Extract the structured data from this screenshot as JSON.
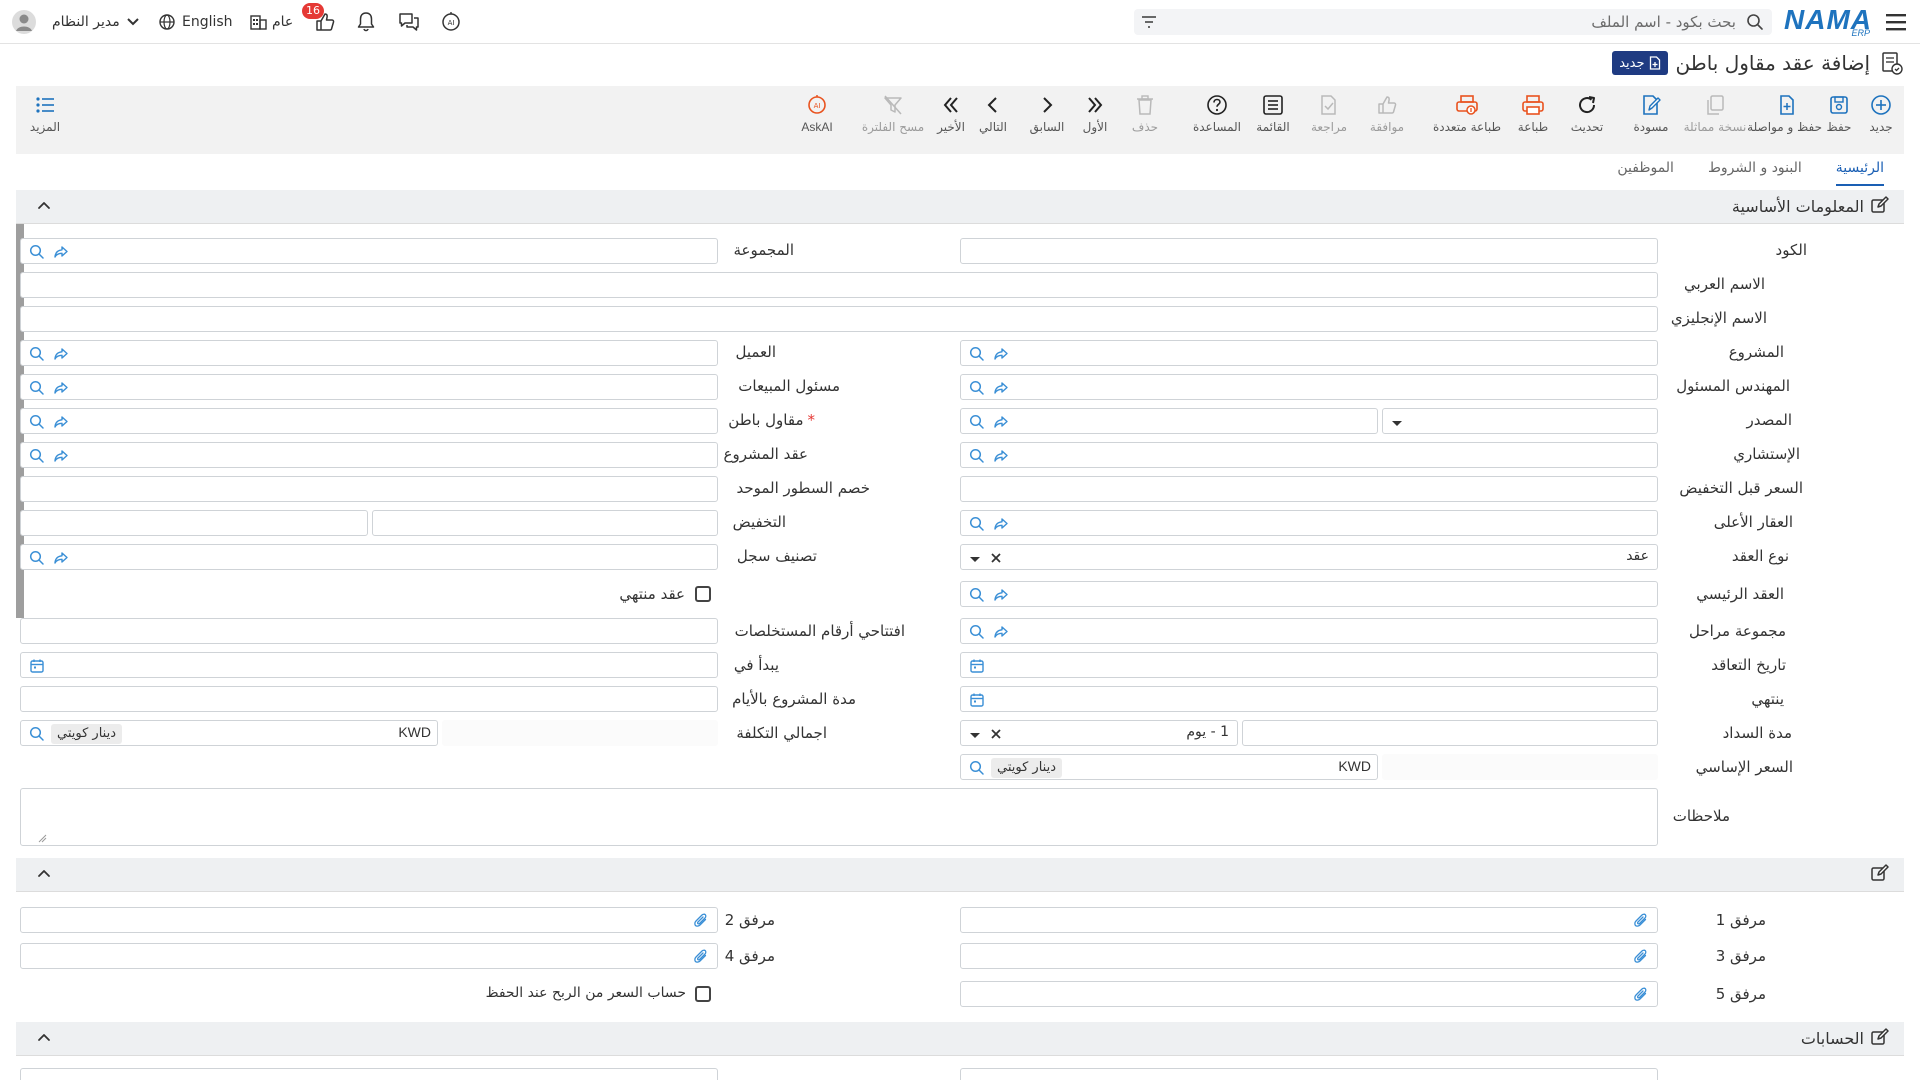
{
  "topbar": {
    "search_placeholder": "بحث بكود - اسم الملف",
    "user_name": "مدير النظام",
    "language": "English",
    "branch": "عام",
    "notification_count": "16",
    "logo_text": "NAMA",
    "logo_sub": "ERP"
  },
  "header": {
    "title": "إضافة عقد مقاول باطن",
    "badge": "جديد"
  },
  "toolbar": {
    "new": "جديد",
    "save": "حفظ",
    "save_continue": "حفظ و مواصلة",
    "copy": "نسخة مماثلة",
    "draft": "مسودة",
    "refresh": "تحديث",
    "print": "طباعة",
    "multi_print": "طباعة متعددة",
    "approve": "موافقة",
    "review": "مراجعة",
    "list": "القائمة",
    "help": "المساعدة",
    "delete": "حذف",
    "first": "الأول",
    "prev": "السابق",
    "next": "التالي",
    "last": "الأخير",
    "clear_filter": "مسح الفلترة",
    "ask_ai": "AskAI",
    "more": "المزيد"
  },
  "tabs": [
    "الرئيسية",
    "البنود و الشروط",
    "الموظفين"
  ],
  "basic_section": {
    "title": "المعلومات الأساسية",
    "labels": {
      "code": "الكود",
      "group": "المجموعة",
      "arabic_name": "الاسم العربي",
      "english_name": "الاسم الإنجليزي",
      "project": "المشروع",
      "customer": "العميل",
      "engineer": "المهندس المسئول",
      "sales_person": "مسئول المبيعات",
      "source": "المصدر",
      "subcontractor": "مقاول باطن",
      "consultant": "الإستشاري",
      "project_contract": "عقد المشروع",
      "price_before_discount": "السعر قبل التخفيض",
      "unified_line_discount": "خصم السطور الموحد",
      "parent_property": "العقار الأعلى",
      "discount": "التخفيض",
      "contract_type": "نوع العقد",
      "record_classification": "تصنيف سجل",
      "main_contract": "العقد الرئيسي",
      "contract_ended": "عقد منتهي",
      "phases_group": "مجموعة مراحل",
      "invoice_opening_numbers": "افتتاحي أرقام المستخلصات",
      "contract_date": "تاريخ التعاقد",
      "starts_at": "يبدأ في",
      "ends": "ينتهي",
      "project_duration_days": "مدة المشروع بالأيام",
      "payment_period": "مدة السداد",
      "total_cost": "اجمالي التكلفة",
      "base_price": "السعر الإساسي",
      "notes": "ملاحظات"
    },
    "values": {
      "contract_type": "عقد",
      "payment_period": "1 - يوم",
      "currency_code": "KWD",
      "currency_name": "دينار كويتي"
    }
  },
  "attachments_section": {
    "labels": {
      "att1": "مرفق 1",
      "att2": "مرفق 2",
      "att3": "مرفق 3",
      "att4": "مرفق 4",
      "att5": "مرفق 5",
      "calc_price": "حساب السعر من الربح عند الحفظ"
    }
  },
  "accounts_section": {
    "title": "الحسابات"
  }
}
